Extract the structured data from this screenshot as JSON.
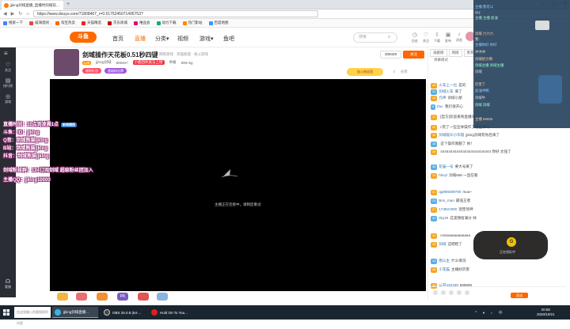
{
  "browser": {
    "tab_title": "jjking剑域直播_直播时剑域双…",
    "url": "https://www.douyu.com/71808467_r=0.5175245071495753?",
    "bookmarks": [
      "搜索一下",
      "威海悠闲",
      "淘宝热卖",
      "天猫精选",
      "京东商城",
      "唯品会",
      "动力下载",
      "热门影站",
      "百度地图"
    ]
  },
  "site": {
    "logo": "斗鱼",
    "nav": [
      "首页",
      "直播",
      "分类▾",
      "视频",
      "游戏▾",
      "鱼吧"
    ],
    "search_placeholder": "搜索",
    "header_icons": [
      "历史",
      "关注",
      "下载",
      "发布",
      "消息"
    ]
  },
  "left_nav": [
    "关注",
    "排行榜",
    "游戏",
    "客服"
  ],
  "room": {
    "title": "剑域操作天花板0.51秒四键",
    "category_tags": "神秘 · 网络游戏 · 英雄联盟 · 格斗游戏",
    "streamer": "jjking剑域",
    "level": "Lv5",
    "room_id": "808467",
    "tag": "小鹿团体奥法上榜",
    "report": "举报",
    "followers": "309429",
    "follow_label": "关注",
    "hot": "999+kg",
    "badges": [
      "福利礼包",
      "超级粉丝牌"
    ],
    "share": "分享",
    "banner": "加入粉丝团"
  },
  "player": {
    "loading_text": "主播正在连接中，请稍后重试"
  },
  "overlay": {
    "lines": [
      "直播时间：10点到凌晨1点",
      "斗鱼：ID：jjking",
      "Q音：剑域熊猫jjking",
      "B站：剑域熊猫jjking",
      "抖音：剑域熊猫jjking",
      "剑域粉丝群：124576213",
      "订阅剑域 超级粉丝团加入",
      "主播QQ：jjking10000"
    ],
    "tag": "新闻播报"
  },
  "chat": {
    "tabs": [
      "贡献榜",
      "周榜",
      "贵宾"
    ],
    "mode": "弹幕模式",
    "messages": [
      {
        "lv": "46",
        "name": "火车上一位",
        "text": "是的"
      },
      {
        "lv": "31",
        "name": "剑域火车",
        "text": "来了"
      },
      {
        "lv": "18",
        "name": "元神",
        "text": "剑域小屋"
      },
      {
        "lv": "9",
        "name": "Dw:",
        "text": "我们很开心"
      },
      {
        "lv": "12",
        "name": "",
        "text": "[官方]欢迎来到直播间"
      },
      {
        "lv": "22",
        "name": "",
        "text": "c究了一些全体操作了也全体吗"
      },
      {
        "lv": "30",
        "name": "剑域观众小华丽",
        "text": "jjking剑域有你后来了"
      },
      {
        "lv": "15",
        "name": "",
        "text": "这个操作我服了 帅！"
      },
      {
        "lv": "28",
        "name": "",
        "text": "4444444444444444444444444 你好 太强了"
      },
      {
        "lv": "36",
        "name": "花猫一号",
        "text": "要大号来了"
      },
      {
        "lv": "19",
        "name": "hlmyl",
        "text": "剑域666 一直在看"
      },
      {
        "lv": "21",
        "name": "qq885589780",
        "text": "mua~"
      },
      {
        "lv": "23",
        "name": "Bon_man",
        "text": "最强王者"
      },
      {
        "lv": "27",
        "name": "173821900",
        "text": "宠臣领神"
      },
      {
        "lv": "33",
        "name": "sky19",
        "text": "这波我给满分 帅"
      },
      {
        "lv": "10",
        "name": "",
        "text": "cosaaaaaaaaaaaa"
      },
      {
        "lv": "25",
        "name": "剑域",
        "text": "这把稳了"
      },
      {
        "lv": "14",
        "name": "雨公主",
        "text": "什么情况"
      },
      {
        "lv": "38",
        "name": "小花猫",
        "text": "主播好厉害"
      },
      {
        "lv": "40",
        "name": "公开433199",
        "text": "888888"
      }
    ],
    "input_placeholder": "",
    "send_label": "发送"
  },
  "danmu": {
    "lines": [
      "主播:我可以",
      "Qq:",
      "主播 主播 加油",
      "剑域 六六六",
      "我:",
      "主播你好 你好",
      "冲冲冲",
      "剑域给力啊",
      "剑域主播 剑域主播",
      "剑域",
      "厉害了",
      "加油冲啊",
      "剑域牛",
      "剑域 剑域",
      "主播 66666"
    ]
  },
  "popup": {
    "circle": "G",
    "text": "正在排队中"
  },
  "gifts": [
    "礼物1",
    "礼物2",
    "礼物3",
    "礼物4",
    "PK",
    "礼物6"
  ],
  "taskbar": {
    "search": "在这里输入你要搜索的内容",
    "items": [
      "jjking剑域直播...",
      "OBS 25.0.8 (64-...",
      "Hold On To You..."
    ],
    "time": "20:56",
    "date": "2020/10/21",
    "tray": "^ ♦ ♪ 中"
  },
  "colors": {
    "accent": "#ff6a00",
    "danmu_bg": "#1e3a56"
  }
}
